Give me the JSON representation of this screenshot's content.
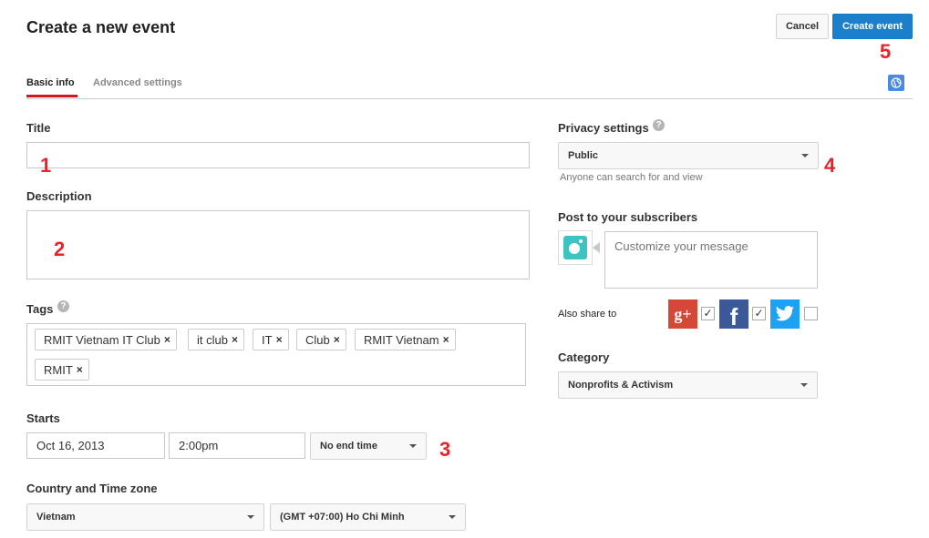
{
  "header": {
    "title": "Create a new event",
    "cancel_label": "Cancel",
    "create_label": "Create event"
  },
  "tabs": [
    {
      "label": "Basic info",
      "active": true
    },
    {
      "label": "Advanced settings",
      "active": false
    }
  ],
  "markers": [
    "1",
    "2",
    "3",
    "4",
    "5"
  ],
  "form": {
    "title_label": "Title",
    "title_value": "",
    "description_label": "Description",
    "description_value": "",
    "tags_label": "Tags",
    "tags": [
      "RMIT Vietnam IT Club",
      "it club",
      "IT",
      "Club",
      "RMIT Vietnam",
      "RMIT"
    ],
    "tag_remove_glyph": "×",
    "starts_label": "Starts",
    "start_date": "Oct 16, 2013",
    "start_time": "2:00pm",
    "end_time_option": "No end time",
    "country_tz_label": "Country and Time zone",
    "country": "Vietnam",
    "timezone": "(GMT +07:00) Ho Chi Minh"
  },
  "sidebar": {
    "privacy_label": "Privacy settings",
    "privacy_value": "Public",
    "privacy_helper": "Anyone can search for and view",
    "post_label": "Post to your subscribers",
    "message_placeholder": "Customize your message",
    "also_share_label": "Also share to",
    "share_targets": [
      {
        "name": "Google+",
        "glyph": "g+",
        "checked": true,
        "color": "#d34836"
      },
      {
        "name": "Facebook",
        "glyph": "f",
        "checked": true,
        "color": "#3b5998"
      },
      {
        "name": "Twitter",
        "glyph": "t",
        "checked": false,
        "color": "#1da1f2"
      }
    ],
    "category_label": "Category",
    "category_value": "Nonprofits & Activism"
  },
  "icons": {
    "help": "?",
    "check": "✓",
    "globe": "globe-icon"
  },
  "colors": {
    "accent_blue": "#1b7fcc",
    "tab_red": "#cc181e",
    "marker_red": "#e8232a"
  }
}
